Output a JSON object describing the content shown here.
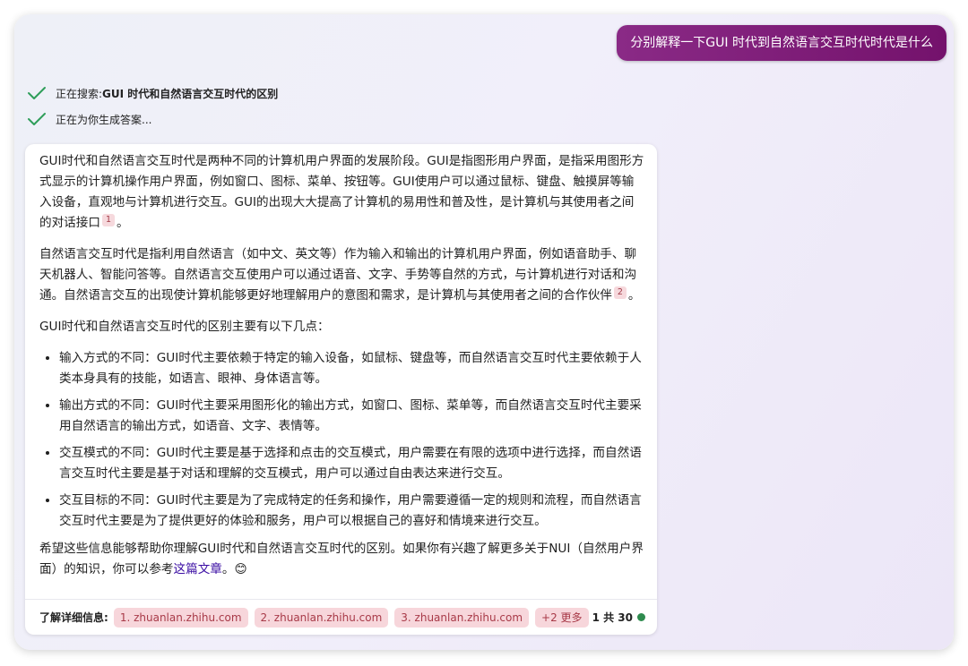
{
  "user_message": "分别解释一下GUI 时代到自然语言交互时代时代是什么",
  "status": [
    {
      "prefix": "正在搜索: ",
      "query": "GUI 时代和自然语言交互时代的区别",
      "icon": "checkmark-icon"
    },
    {
      "prefix": "正在为你生成答案...",
      "query": "",
      "icon": "checkmark-icon"
    }
  ],
  "answer": {
    "p1": "GUI时代和自然语言交互时代是两种不同的计算机用户界面的发展阶段。GUI是指图形用户界面，是指采用图形方式显示的计算机操作用户界面，例如窗口、图标、菜单、按钮等。GUI使用户可以通过鼠标、键盘、触摸屏等输入设备，直观地与计算机进行交互。GUI的出现大大提高了计算机的易用性和普及性，是计算机与其使用者之间的对话接口",
    "p1_cite": "1",
    "p1_end": "。",
    "p2": "自然语言交互时代是指利用自然语言（如中文、英文等）作为输入和输出的计算机用户界面，例如语音助手、聊天机器人、智能问答等。自然语言交互使用户可以通过语音、文字、手势等自然的方式，与计算机进行对话和沟通。自然语言交互的出现使计算机能够更好地理解用户的意图和需求，是计算机与其使用者之间的合作伙伴",
    "p2_cite": "2",
    "p2_end": "。",
    "p3": "GUI时代和自然语言交互时代的区别主要有以下几点：",
    "bullets": [
      "输入方式的不同：GUI时代主要依赖于特定的输入设备，如鼠标、键盘等，而自然语言交互时代主要依赖于人类本身具有的技能，如语言、眼神、身体语言等。",
      "输出方式的不同：GUI时代主要采用图形化的输出方式，如窗口、图标、菜单等，而自然语言交互时代主要采用自然语言的输出方式，如语音、文字、表情等。",
      "交互模式的不同：GUI时代主要是基于选择和点击的交互模式，用户需要在有限的选项中进行选择，而自然语言交互时代主要是基于对话和理解的交互模式，用户可以通过自由表达来进行交互。",
      "交互目标的不同：GUI时代主要是为了完成特定的任务和操作，用户需要遵循一定的规则和流程，而自然语言交互时代主要是为了提供更好的体验和服务，用户可以根据自己的喜好和情境来进行交互。"
    ],
    "p4_before": "希望这些信息能够帮助你理解GUI时代和自然语言交互时代的区别。如果你有兴趣了解更多关于NUI（自然用户界面）的知识，你可以参考",
    "p4_link": "这篇文章",
    "p4_after": "。",
    "emoji": "😊"
  },
  "learn_more": {
    "label": "了解详细信息:",
    "sources": [
      "1. zhuanlan.zhihu.com",
      "2. zhuanlan.zhihu.com",
      "3. zhuanlan.zhihu.com"
    ],
    "more": "+2 更多"
  },
  "page_counter": "1 共 30",
  "colors": {
    "user_bubble": "#7a1a74",
    "check": "#2f9e5a",
    "chip_bg": "#f7d6db",
    "chip_text": "#a83a48",
    "status_dot": "#2e8b4e"
  }
}
